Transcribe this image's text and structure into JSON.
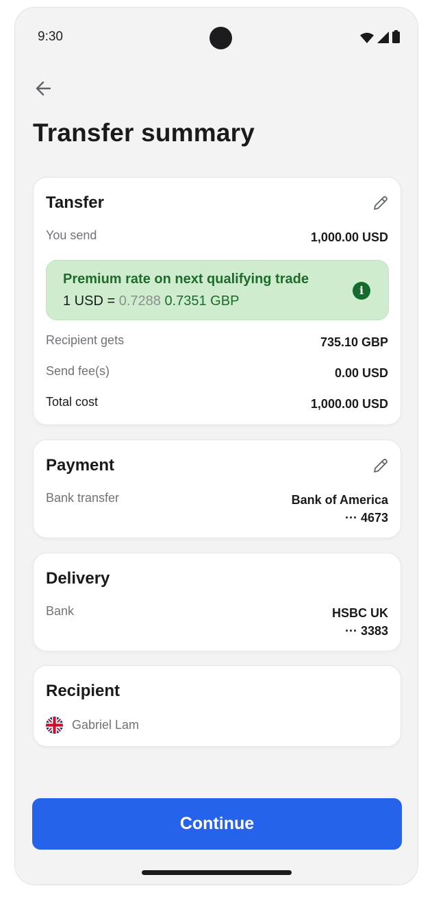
{
  "status_bar": {
    "time": "9:30"
  },
  "page": {
    "title": "Transfer summary"
  },
  "transfer": {
    "title": "Tansfer",
    "you_send_label": "You send",
    "you_send_value": "1,000.00 USD",
    "promo": {
      "headline": "Premium rate on next qualifying trade",
      "rate_prefix": "1 USD = ",
      "old_rate": "0.7288",
      "new_rate": "0.7351 GBP"
    },
    "recipient_gets_label": "Recipient gets",
    "recipient_gets_value": "735.10 GBP",
    "fee_label": "Send fee(s)",
    "fee_value": "0.00 USD",
    "total_label": "Total cost",
    "total_value": "1,000.00 USD"
  },
  "payment": {
    "title": "Payment",
    "method_label": "Bank transfer",
    "bank_name": "Bank of America",
    "account_mask": "··· 4673"
  },
  "delivery": {
    "title": "Delivery",
    "method_label": "Bank",
    "bank_name": "HSBC UK",
    "account_mask": "··· 3383"
  },
  "recipient": {
    "title": "Recipient",
    "name": "Gabriel Lam",
    "flag_icon": "uk-flag-icon"
  },
  "actions": {
    "continue_label": "Continue"
  },
  "colors": {
    "primary": "#2563eb",
    "promo_bg": "#cfeccf",
    "promo_text": "#1e6b2b",
    "background": "#f3f3f4"
  }
}
